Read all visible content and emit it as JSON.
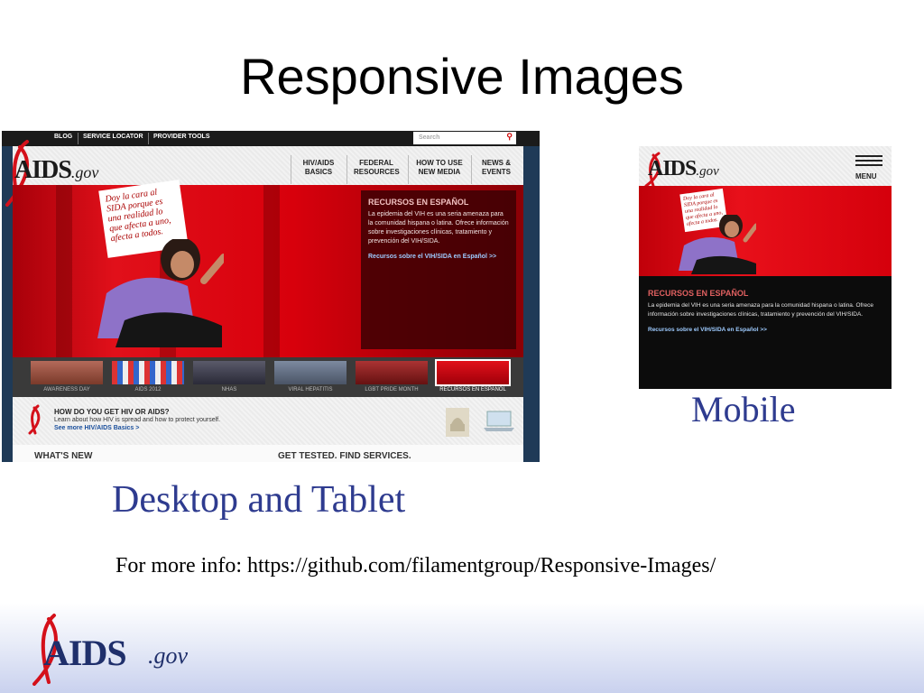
{
  "slide": {
    "title": "Responsive Images",
    "caption_desktop": "Desktop and Tablet",
    "caption_mobile": "Mobile",
    "more_info": "For more info: https://github.com/filamentgroup/Responsive-Images/"
  },
  "footer": {
    "logo_main": "AIDS",
    "logo_suffix": ".gov"
  },
  "colors": {
    "caption": "#2e3b8f",
    "hero_red": "#e1101a",
    "nav_dark": "#1b1b1b",
    "link_blue": "#9ecbff"
  },
  "desktop": {
    "topnav": [
      "BLOG",
      "SERVICE LOCATOR",
      "PROVIDER TOOLS"
    ],
    "search_placeholder": "Search",
    "logo_main": "AIDS",
    "logo_suffix": ".gov",
    "mainnav": [
      {
        "line1": "HIV/AIDS",
        "line2": "BASICS"
      },
      {
        "line1": "FEDERAL",
        "line2": "RESOURCES"
      },
      {
        "line1": "HOW TO USE",
        "line2": "NEW MEDIA"
      },
      {
        "line1": "NEWS &",
        "line2": "EVENTS"
      }
    ],
    "sign_text": "Doy la cara al SIDA porque es una realidad lo que afecta a uno, afecta a todos.",
    "recursos": {
      "heading": "RECURSOS EN ESPAÑOL",
      "body": "La epidemia del VIH es una seria amenaza para la comunidad hispana o latina. Ofrece información sobre investigaciones clínicas, tratamiento y prevención del VIH/SIDA.",
      "link": "Recursos sobre el VIH/SIDA en Español >>"
    },
    "thumbs": [
      "AWARENESS DAY",
      "AIDS 2012",
      "NHAS",
      "VIRAL HEPATITIS",
      "LGBT PRIDE MONTH",
      "RECURSOS EN ESPAÑOL"
    ],
    "promo": {
      "question": "HOW DO YOU GET HIV OR AIDS?",
      "desc": "Learn about how HIV is spread and how to protect yourself.",
      "link": "See more HIV/AIDS Basics >"
    },
    "bottom": {
      "left": "WHAT'S NEW",
      "right": "GET TESTED. FIND SERVICES."
    }
  },
  "mobile": {
    "logo_main": "AIDS",
    "logo_suffix": ".gov",
    "menu_label": "MENU",
    "sign_text": "Doy la cara al SIDA porque es una realidad lo que afecta a uno, afecta a todos.",
    "recursos": {
      "heading": "RECURSOS EN ESPAÑOL",
      "body": "La epidemia del VIH es una seria amenaza para la comunidad hispana o latina. Ofrece información sobre investigaciones clínicas, tratamiento y prevención del VIH/SIDA.",
      "link": "Recursos sobre el VIH/SIDA en Español >>"
    }
  }
}
